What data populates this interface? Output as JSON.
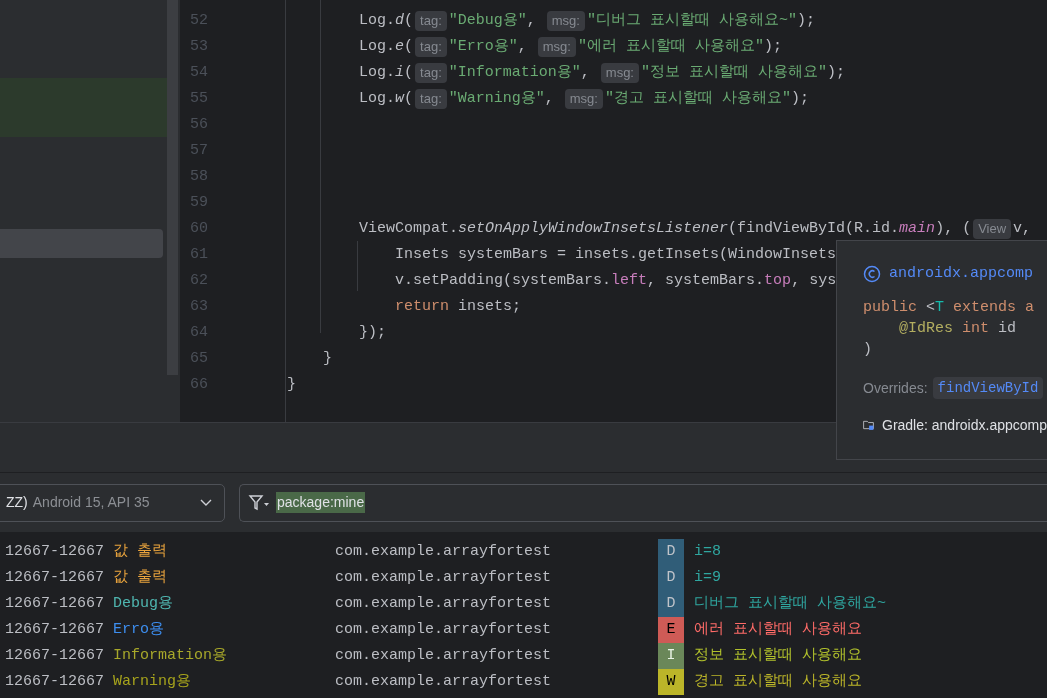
{
  "editor": {
    "lines": [
      {
        "number": "52",
        "tokens": [
          {
            "kind": "plain",
            "text": "        Log."
          },
          {
            "kind": "italic",
            "text": "d"
          },
          {
            "kind": "plain",
            "text": "("
          },
          {
            "kind": "hint",
            "text": "tag:"
          },
          {
            "kind": "string",
            "text": "\"Debug용\""
          },
          {
            "kind": "plain",
            "text": ", "
          },
          {
            "kind": "hint",
            "text": "msg:"
          },
          {
            "kind": "string",
            "text": "\"디버그 표시할때 사용해요~\""
          },
          {
            "kind": "plain",
            "text": ");"
          }
        ]
      },
      {
        "number": "53",
        "tokens": [
          {
            "kind": "plain",
            "text": "        Log."
          },
          {
            "kind": "italic",
            "text": "e"
          },
          {
            "kind": "plain",
            "text": "("
          },
          {
            "kind": "hint",
            "text": "tag:"
          },
          {
            "kind": "string",
            "text": "\"Erro용\""
          },
          {
            "kind": "plain",
            "text": ", "
          },
          {
            "kind": "hint",
            "text": "msg:"
          },
          {
            "kind": "string",
            "text": "\"에러 표시할때 사용해요\""
          },
          {
            "kind": "plain",
            "text": ");"
          }
        ]
      },
      {
        "number": "54",
        "tokens": [
          {
            "kind": "plain",
            "text": "        Log."
          },
          {
            "kind": "italic",
            "text": "i"
          },
          {
            "kind": "plain",
            "text": "("
          },
          {
            "kind": "hint",
            "text": "tag:"
          },
          {
            "kind": "string",
            "text": "\"Information용\""
          },
          {
            "kind": "plain",
            "text": ", "
          },
          {
            "kind": "hint",
            "text": "msg:"
          },
          {
            "kind": "string",
            "text": "\"정보 표시할때 사용해요\""
          },
          {
            "kind": "plain",
            "text": ");"
          }
        ]
      },
      {
        "number": "55",
        "tokens": [
          {
            "kind": "plain",
            "text": "        Log."
          },
          {
            "kind": "italic",
            "text": "w"
          },
          {
            "kind": "plain",
            "text": "("
          },
          {
            "kind": "hint",
            "text": "tag:"
          },
          {
            "kind": "string",
            "text": "\"Warning용\""
          },
          {
            "kind": "plain",
            "text": ", "
          },
          {
            "kind": "hint",
            "text": "msg:"
          },
          {
            "kind": "string",
            "text": "\"경고 표시할때 사용해요\""
          },
          {
            "kind": "plain",
            "text": ");"
          }
        ]
      },
      {
        "number": "56"
      },
      {
        "number": "57"
      },
      {
        "number": "58"
      },
      {
        "number": "59"
      },
      {
        "number": "60",
        "tokens": [
          {
            "kind": "plain",
            "text": "        ViewCompat."
          },
          {
            "kind": "italic",
            "text": "setOnApplyWindowInsetsListener"
          },
          {
            "kind": "plain",
            "text": "(findViewById(R.id."
          },
          {
            "kind": "field_italic",
            "text": "main"
          },
          {
            "kind": "plain",
            "text": "), ("
          },
          {
            "kind": "hint",
            "text": "View"
          },
          {
            "kind": "plain",
            "text": "v,"
          }
        ]
      },
      {
        "number": "61",
        "tokens": [
          {
            "kind": "plain",
            "text": "            Insets systemBars = insets.getInsets(WindowInsets"
          }
        ]
      },
      {
        "number": "62",
        "tokens": [
          {
            "kind": "plain",
            "text": "            v.setPadding(systemBars."
          },
          {
            "kind": "field",
            "text": "left"
          },
          {
            "kind": "plain",
            "text": ", systemBars."
          },
          {
            "kind": "field",
            "text": "top"
          },
          {
            "kind": "plain",
            "text": ", sys"
          }
        ]
      },
      {
        "number": "63",
        "tokens": [
          {
            "kind": "keyword",
            "text": "            return"
          },
          {
            "kind": "plain",
            "text": " insets;"
          }
        ]
      },
      {
        "number": "64",
        "tokens": [
          {
            "kind": "plain",
            "text": "        });"
          }
        ]
      },
      {
        "number": "65",
        "tokens": [
          {
            "kind": "plain",
            "text": "    }"
          }
        ]
      },
      {
        "number": "66",
        "tokens": [
          {
            "kind": "plain",
            "text": "}"
          }
        ]
      }
    ]
  },
  "popup": {
    "title": "androidx.appcomp",
    "signature": [
      [
        {
          "kind": "keyword",
          "text": "public"
        },
        {
          "kind": "plain",
          "text": " <"
        },
        {
          "kind": "type",
          "text": "T"
        },
        {
          "kind": "keyword",
          "text": " extends a"
        }
      ],
      [
        {
          "kind": "annotation",
          "text": "    @IdRes"
        },
        {
          "kind": "keyword",
          "text": " int"
        },
        {
          "kind": "plain",
          "text": " id"
        }
      ],
      [
        {
          "kind": "plain",
          "text": ")"
        }
      ]
    ],
    "overrides_label": "Overrides:",
    "overrides_link": "findViewById",
    "source": "Gradle: androidx.appcomp"
  },
  "logcat": {
    "device": {
      "name": "ZZ)",
      "detail": "Android 15, API 35"
    },
    "filter": "package:mine",
    "rows": [
      {
        "pid": "12667-12667",
        "tag": "값 출력",
        "color": "#e8a33d",
        "package": "com.example.arrayfortest",
        "priority": "D",
        "kind": "debug",
        "message": "i=8"
      },
      {
        "pid": "12667-12667",
        "tag": "값 출력",
        "color": "#e8a33d",
        "package": "com.example.arrayfortest",
        "priority": "D",
        "kind": "debug",
        "message": "i=9"
      },
      {
        "pid": "12667-12667",
        "tag": "Debug용",
        "color": "#4fb6b0",
        "package": "com.example.arrayfortest",
        "priority": "D",
        "kind": "debug",
        "message": "디버그 표시할때 사용해요~"
      },
      {
        "pid": "12667-12667",
        "tag": "Erro용",
        "color": "#3d8ef0",
        "package": "com.example.arrayfortest",
        "priority": "E",
        "kind": "error",
        "message": "에러 표시할때 사용해요"
      },
      {
        "pid": "12667-12667",
        "tag": "Information용",
        "color": "#a8a82a",
        "package": "com.example.arrayfortest",
        "priority": "I",
        "kind": "info",
        "message": "정보 표시할때 사용해요"
      },
      {
        "pid": "12667-12667",
        "tag": "Warning용",
        "color": "#a6a31c",
        "package": "com.example.arrayfortest",
        "priority": "W",
        "kind": "warning",
        "message": "경고 표시할때 사용해요"
      }
    ]
  }
}
